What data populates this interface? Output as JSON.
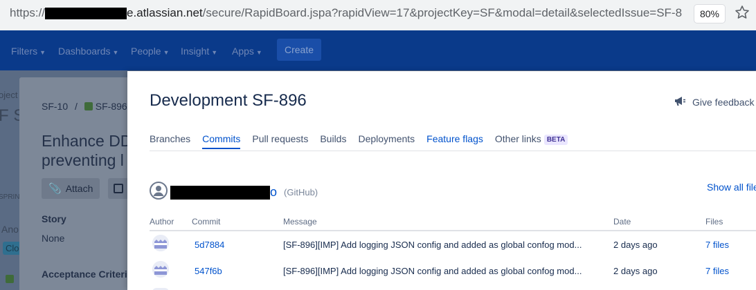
{
  "browser": {
    "url_prefix": "https://",
    "url_domain_suffix": "e.atlassian.net",
    "url_path": "/secure/RapidBoard.jspa?rapidView=17&projectKey=SF&modal=detail&selectedIssue=SF-8",
    "zoom": "80%"
  },
  "nav": {
    "items": [
      {
        "label": "Filters"
      },
      {
        "label": "Dashboards"
      },
      {
        "label": "People"
      },
      {
        "label": "Insight"
      },
      {
        "label": "Apps"
      }
    ],
    "create_label": "Create"
  },
  "background": {
    "project_prefix": "oject",
    "project_initial": "F S",
    "sprint_label": "SPRIN",
    "ano_label": "Ano",
    "clo_label": "Clo"
  },
  "issue": {
    "parent_key": "SF-10",
    "separator": "/",
    "key": "SF-896",
    "title_line1": "Enhance DD",
    "title_line2": "preventing l",
    "attach_label": "Attach",
    "story_label": "Story",
    "story_value": "None",
    "acceptance_label": "Acceptance Criteria"
  },
  "modal": {
    "title": "Development SF-896",
    "feedback_label": "Give feedback",
    "tabs": [
      {
        "label": "Branches",
        "state": "normal"
      },
      {
        "label": "Commits",
        "state": "active"
      },
      {
        "label": "Pull requests",
        "state": "normal"
      },
      {
        "label": "Builds",
        "state": "normal"
      },
      {
        "label": "Deployments",
        "state": "normal"
      },
      {
        "label": "Feature flags",
        "state": "link"
      },
      {
        "label": "Other links",
        "state": "normal"
      }
    ],
    "beta_badge": "BETA",
    "repo": {
      "name_tail": "o",
      "host": "(GitHub)"
    },
    "show_all_label": "Show all file",
    "columns": {
      "author": "Author",
      "commit": "Commit",
      "message": "Message",
      "date": "Date",
      "files": "Files"
    },
    "commits": [
      {
        "hash": "5d7884",
        "message": "[SF-896][IMP] Add logging JSON config and added as global confog mod...",
        "date": "2 days ago",
        "files": "7 files"
      },
      {
        "hash": "547f6b",
        "message": "[SF-896][IMP] Add logging JSON config and added as global confog mod...",
        "date": "2 days ago",
        "files": "7 files"
      }
    ]
  },
  "colors": {
    "link": "#0052cc",
    "beta_bg": "#eae6ff",
    "beta_text": "#403294",
    "nav_bg": "#0a3a8a"
  }
}
